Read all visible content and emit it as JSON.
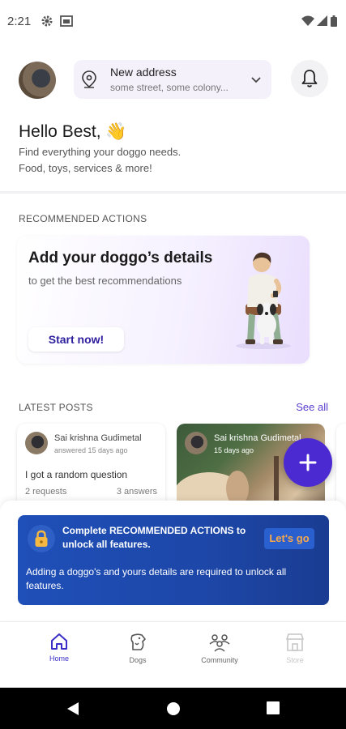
{
  "status_bar": {
    "time": "2:21",
    "icons": [
      "settings-gear-icon",
      "screenshot-icon",
      "wifi-icon",
      "signal-icon",
      "battery-icon"
    ]
  },
  "header": {
    "address_title": "New address",
    "address_subtitle": "some street, some colony...",
    "icons": [
      "location-pin-icon",
      "chevron-down-icon",
      "bell-icon"
    ]
  },
  "greeting": {
    "title": "Hello Best, 👋",
    "subtitle_line1": "Find everything your doggo needs.",
    "subtitle_line2": "Food, toys, services & more!"
  },
  "recommended": {
    "section_label": "RECOMMENDED ACTIONS",
    "card_title": "Add your doggo’s details",
    "card_subtitle": "to get the best recommendations",
    "button_label": "Start now!"
  },
  "latest_posts": {
    "section_label": "LATEST POSTS",
    "see_all_label": "See all",
    "posts": [
      {
        "author": "Sai krishna Gudimetal",
        "meta": "answered 15 days ago",
        "question": "I got a random question",
        "requests": "2 requests",
        "answers": "3 answers"
      },
      {
        "author": "Sai krishna Gudimetal",
        "meta": "15 days ago"
      }
    ]
  },
  "banner": {
    "title": "Complete RECOMMENDED ACTIONS to unlock all features.",
    "button_label": "Let's go",
    "subtitle": "Adding a doggo's and yours details are required to unlock all features."
  },
  "bottom_nav": {
    "items": [
      {
        "label": "Home",
        "state": "active"
      },
      {
        "label": "Dogs",
        "state": "normal"
      },
      {
        "label": "Community",
        "state": "normal"
      },
      {
        "label": "Store",
        "state": "disabled"
      }
    ]
  },
  "colors": {
    "accent": "#4b2ad1",
    "banner_blue": "#1f4fb8",
    "lets_go_text": "#f6a94d"
  }
}
